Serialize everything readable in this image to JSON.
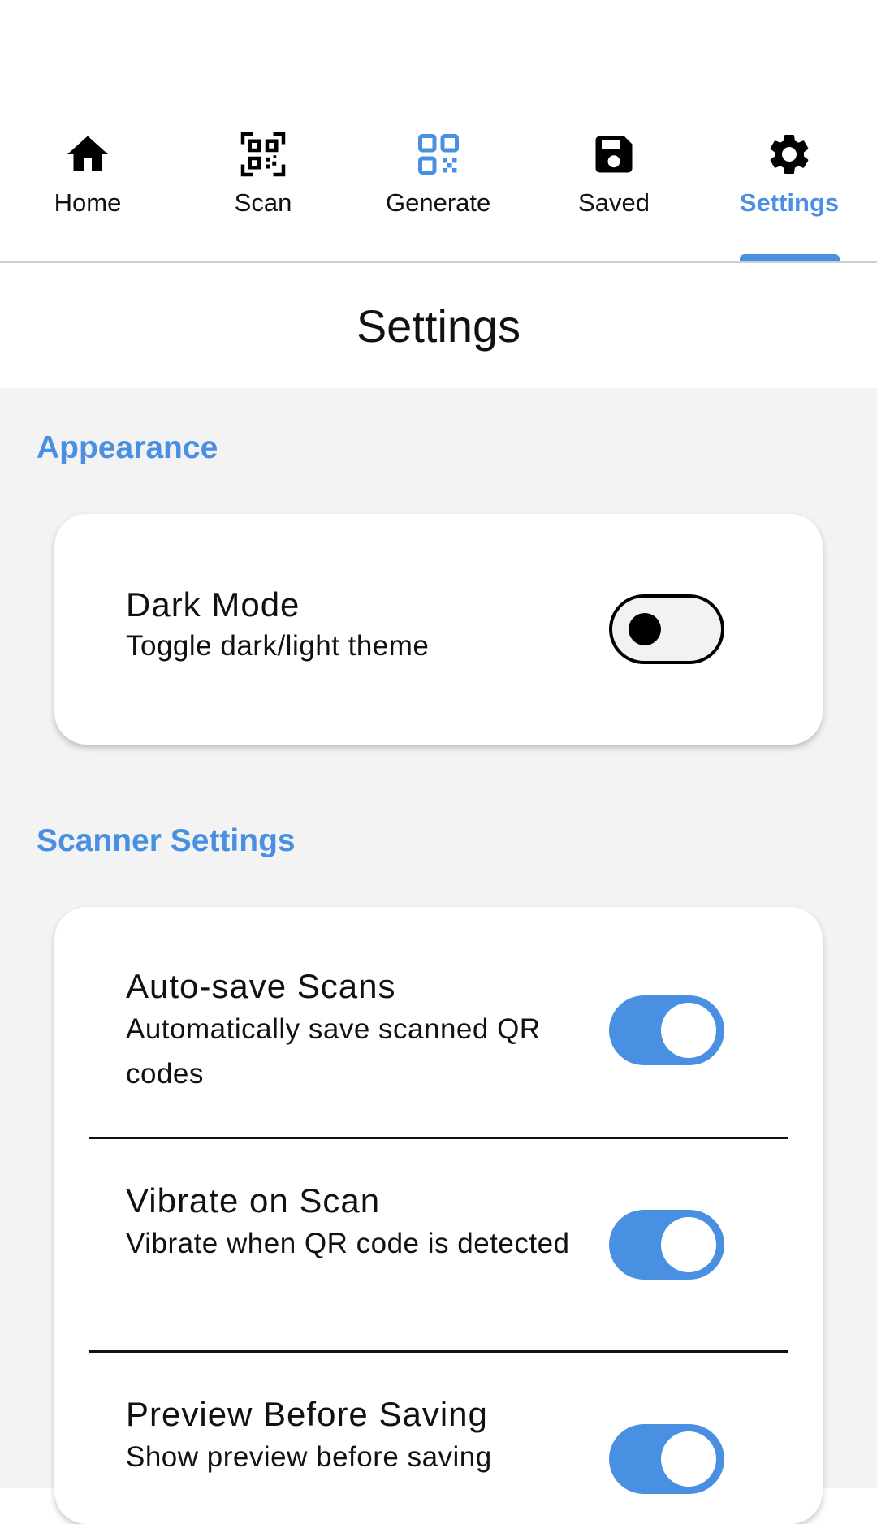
{
  "tabs": [
    {
      "label": "Home",
      "icon": "home-icon",
      "active": false
    },
    {
      "label": "Scan",
      "icon": "qr-scan-icon",
      "active": false
    },
    {
      "label": "Generate",
      "icon": "qr-generate-icon",
      "active": false
    },
    {
      "label": "Saved",
      "icon": "floppy-disk-icon",
      "active": false
    },
    {
      "label": "Settings",
      "icon": "gear-icon",
      "active": true
    }
  ],
  "header": {
    "title": "Settings"
  },
  "sections": [
    {
      "title": "Appearance",
      "items": [
        {
          "title": "Dark Mode",
          "subtitle": "Toggle dark/light theme",
          "enabled": false
        }
      ]
    },
    {
      "title": "Scanner Settings",
      "items": [
        {
          "title": "Auto-save Scans",
          "subtitle": "Automatically save scanned QR codes",
          "enabled": true
        },
        {
          "title": "Vibrate on Scan",
          "subtitle": "Vibrate when QR code is detected",
          "enabled": true
        },
        {
          "title": "Preview Before Saving",
          "subtitle": "Show preview before saving",
          "enabled": true
        }
      ]
    }
  ],
  "colors": {
    "accent": "#4a90e2",
    "background": "#f3f3f3",
    "card": "#ffffff",
    "text": "#111111"
  }
}
